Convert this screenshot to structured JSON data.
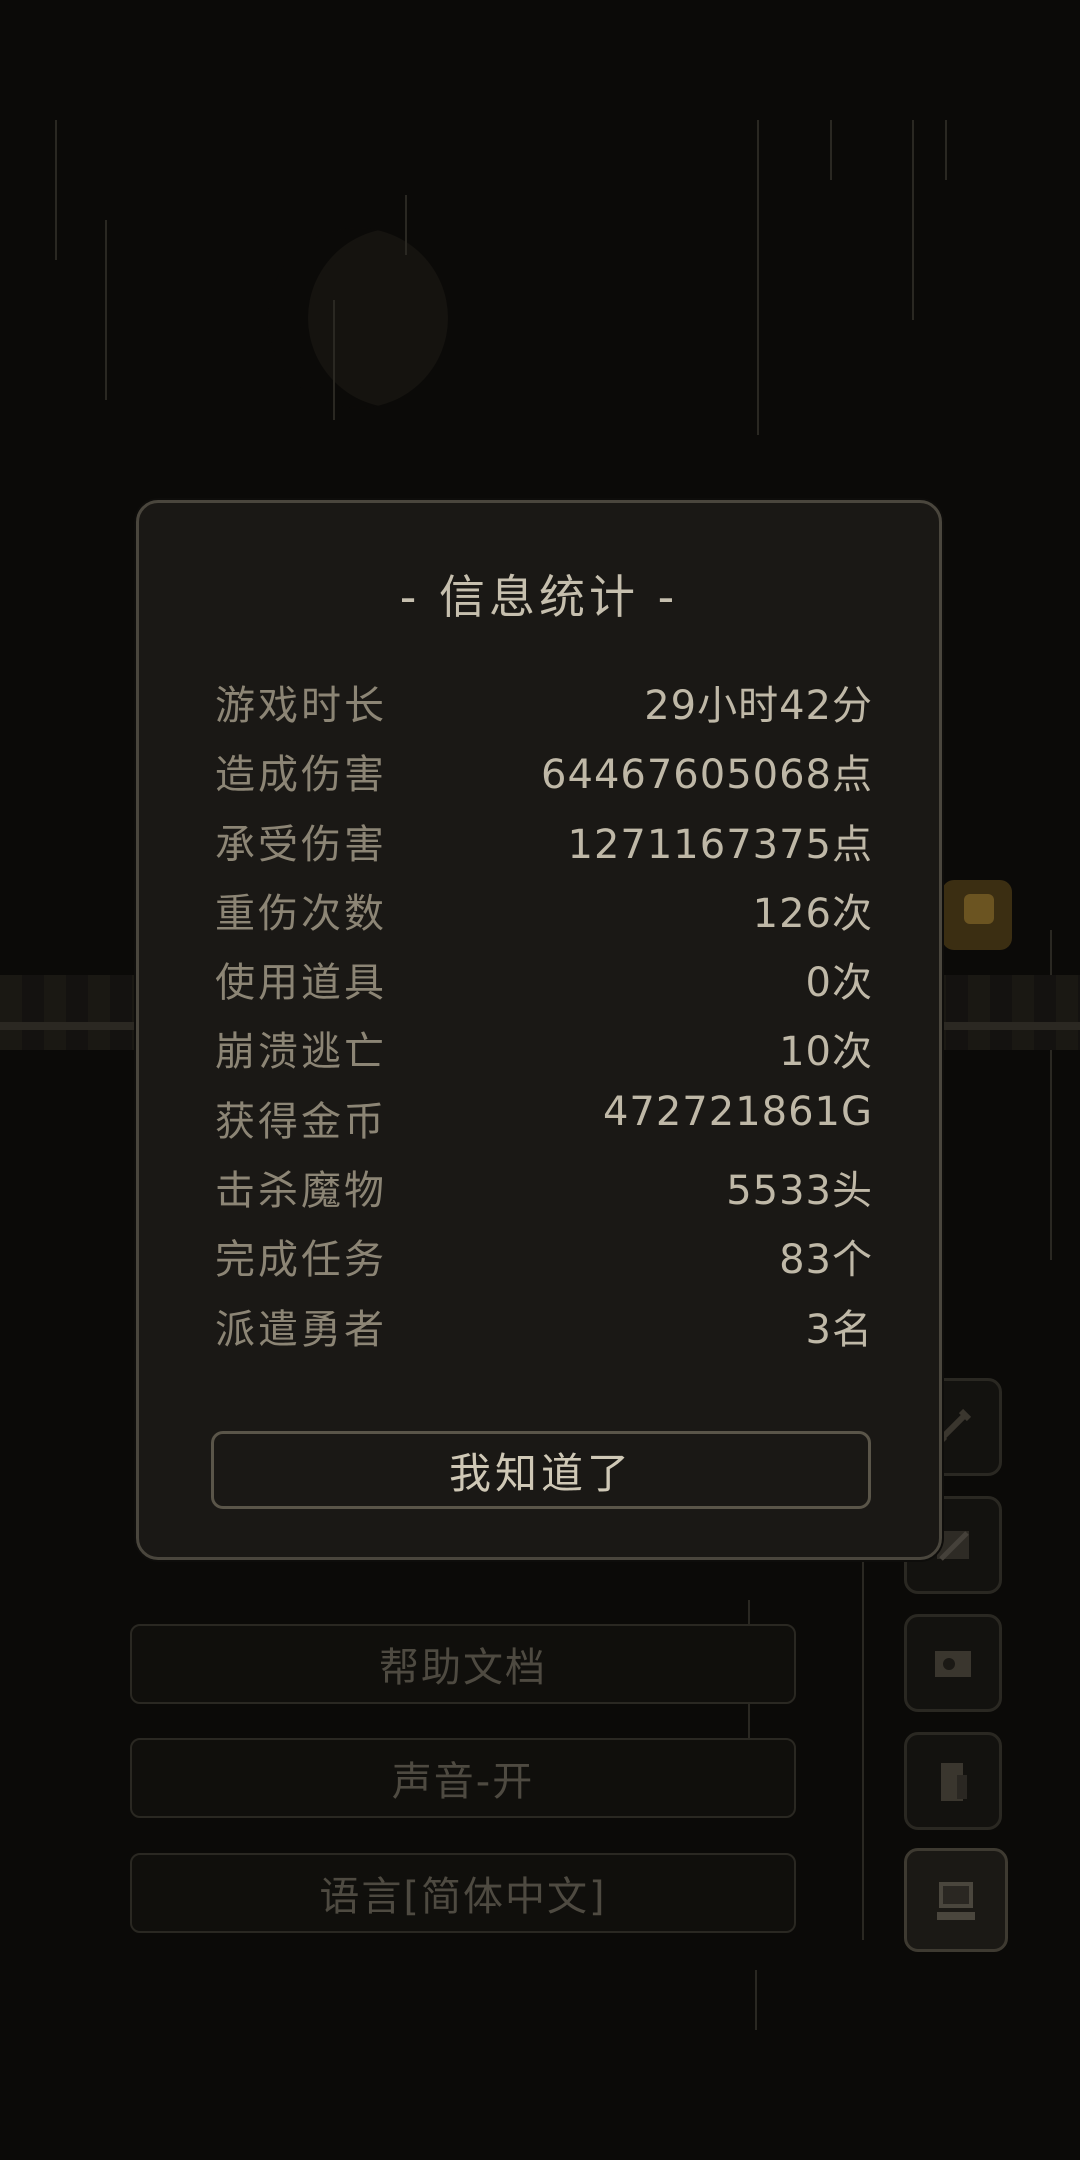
{
  "dialog": {
    "title": "- 信息统计 -",
    "stats": [
      {
        "label": "游戏时长",
        "value": "29小时42分"
      },
      {
        "label": "造成伤害",
        "value": "64467605068点"
      },
      {
        "label": "承受伤害",
        "value": "1271167375点"
      },
      {
        "label": "重伤次数",
        "value": "126次"
      },
      {
        "label": "使用道具",
        "value": "0次"
      },
      {
        "label": "崩溃逃亡",
        "value": "10次"
      },
      {
        "label": "获得金币",
        "value": "472721861G"
      },
      {
        "label": "击杀魔物",
        "value": "5533头"
      },
      {
        "label": "完成任务",
        "value": "83个"
      },
      {
        "label": "派遣勇者",
        "value": "3名"
      }
    ],
    "confirm_label": "我知道了"
  },
  "menu": {
    "items": [
      "帮助文档",
      "声音-开",
      "语言[简体中文]"
    ]
  },
  "side_icons": [
    "sword-icon",
    "scroll-icon",
    "map-icon",
    "door-icon",
    "computer-icon"
  ],
  "colors": {
    "background": "#0b0a08",
    "dialog_bg": "#1a1815",
    "dialog_border": "#4a463d",
    "label_text": "#8c8575",
    "value_text": "#bfb8a7"
  }
}
